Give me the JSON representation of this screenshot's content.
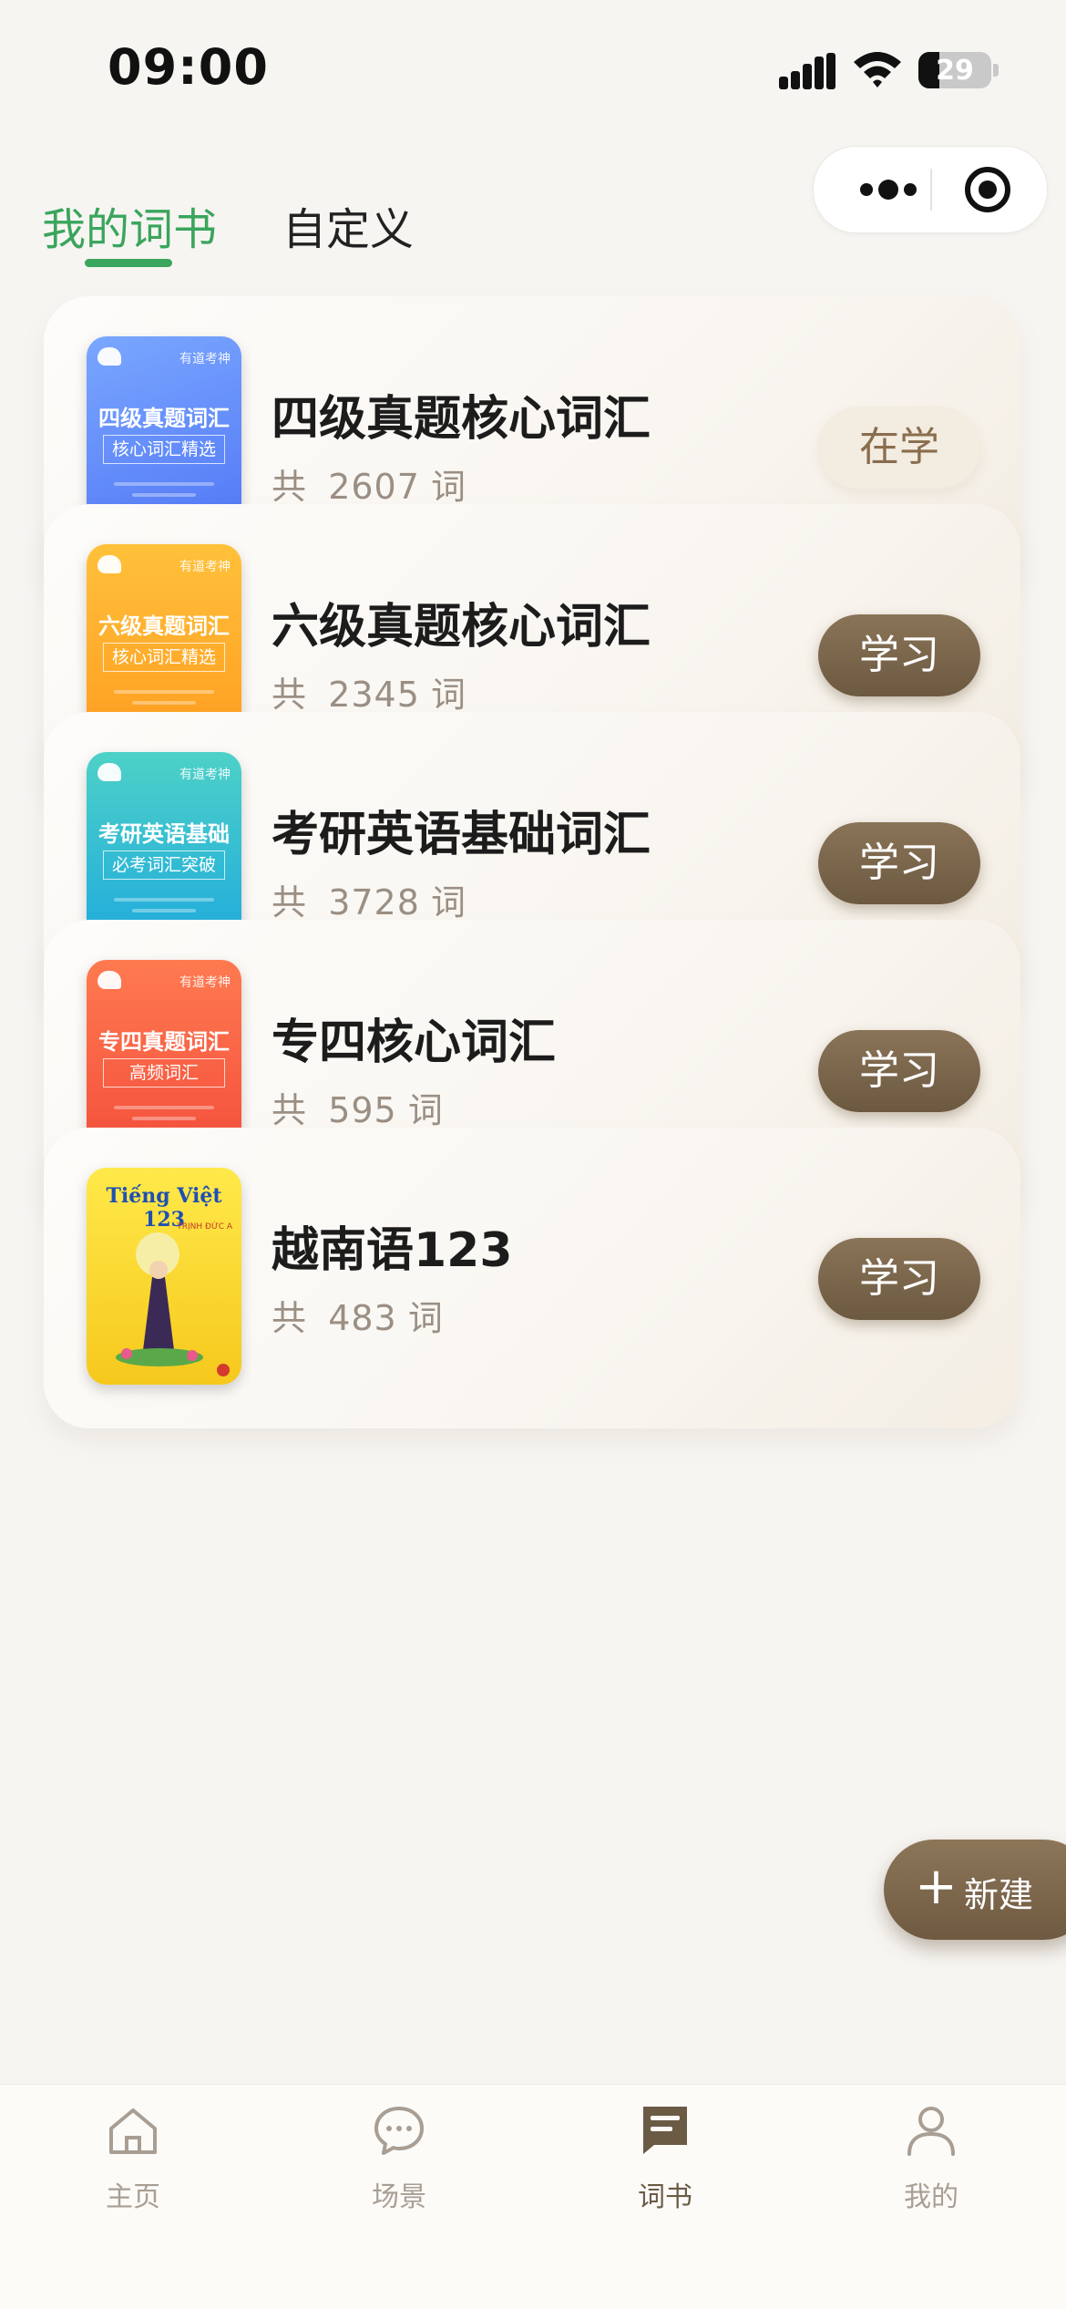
{
  "status_bar": {
    "time": "09:00",
    "battery": "29",
    "battery_level": 0.29
  },
  "tabs": [
    {
      "label": "我的词书",
      "active": true
    },
    {
      "label": "自定义",
      "active": false
    }
  ],
  "books": [
    {
      "title": "四级真题核心词汇",
      "count_prefix": "共",
      "count": "2607",
      "count_suffix": "词",
      "action": "在学",
      "action_state": "studying",
      "cover": {
        "title": "四级真题词汇",
        "subtitle": "核心词汇精选",
        "brand": "有道考神",
        "colors": [
          "#7aa7ff",
          "#4f74f5"
        ]
      }
    },
    {
      "title": "六级真题核心词汇",
      "count_prefix": "共",
      "count": "2345",
      "count_suffix": "词",
      "action": "学习",
      "action_state": "learn",
      "cover": {
        "title": "六级真题词汇",
        "subtitle": "核心词汇精选",
        "brand": "有道考神",
        "colors": [
          "#ffc13a",
          "#ff9a1f"
        ]
      }
    },
    {
      "title": "考研英语基础词汇",
      "count_prefix": "共",
      "count": "3728",
      "count_suffix": "词",
      "action": "学习",
      "action_state": "learn",
      "cover": {
        "title": "考研英语基础",
        "subtitle": "必考词汇突破",
        "brand": "有道考神",
        "colors": [
          "#4dd1c7",
          "#1aa6e0"
        ]
      }
    },
    {
      "title": "专四核心词汇",
      "count_prefix": "共",
      "count": "595",
      "count_suffix": "词",
      "action": "学习",
      "action_state": "learn",
      "cover": {
        "title": "专四真题词汇",
        "subtitle": "高频词汇",
        "brand": "有道考神",
        "colors": [
          "#ff7a50",
          "#f24a3a"
        ]
      }
    },
    {
      "title": "越南语123",
      "count_prefix": "共",
      "count": "483",
      "count_suffix": "词",
      "action": "学习",
      "action_state": "learn",
      "cover": {
        "title": "Tiếng Việt 123",
        "subtitle": "TRỊNH ĐỨC A",
        "brand": "",
        "colors": [
          "#ffe94a",
          "#f6c81c"
        ]
      }
    }
  ],
  "fab": {
    "label": "新建",
    "icon": "plus-icon"
  },
  "tabbar": [
    {
      "label": "主页",
      "icon": "home-icon",
      "active": false
    },
    {
      "label": "场景",
      "icon": "chat-icon",
      "active": false
    },
    {
      "label": "词书",
      "icon": "book-icon",
      "active": true
    },
    {
      "label": "我的",
      "icon": "user-icon",
      "active": false
    }
  ],
  "colors": {
    "accent_green": "#3aa55c",
    "brown": "#75624a",
    "count_gray": "#9b8f84"
  }
}
